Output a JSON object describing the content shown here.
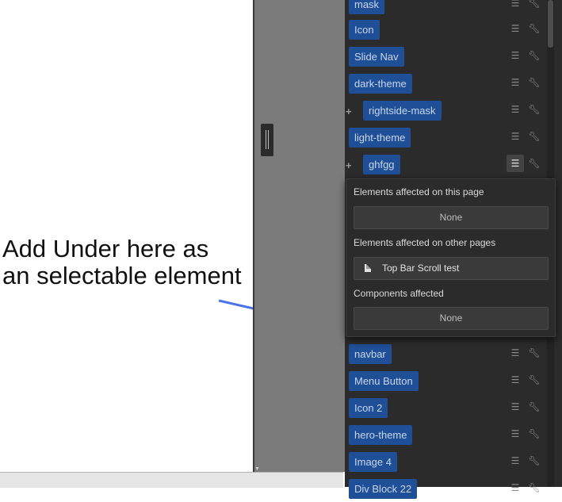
{
  "annotation": {
    "line1": "Add Under here as",
    "line2": "an selectable element"
  },
  "panel": {
    "items": [
      {
        "label": "mask"
      },
      {
        "label": "Icon"
      },
      {
        "label": "Slide Nav"
      },
      {
        "label": "dark-theme"
      },
      {
        "label": "rightside-mask"
      },
      {
        "label": "light-theme"
      },
      {
        "label": "ghfgg"
      },
      {
        "label": "navbar"
      },
      {
        "label": "Menu Button"
      },
      {
        "label": "Icon 2"
      },
      {
        "label": "hero-theme"
      },
      {
        "label": "Image 4"
      },
      {
        "label": "Div Block 22"
      }
    ]
  },
  "popover": {
    "this_page_label": "Elements affected on this page",
    "this_page_value": "None",
    "other_pages_label": "Elements affected on other pages",
    "other_pages_value": "Top Bar Scroll test",
    "components_label": "Components affected",
    "components_value": "None"
  },
  "icons": {
    "list": "list-icon",
    "wrench": "wrench-icon",
    "plus": "plus-icon",
    "document": "document-icon",
    "arrow": "arrow-pointer"
  },
  "colors": {
    "tag_bg": "#1f4f96",
    "panel_bg": "#2b2b2b",
    "arrow": "#4a74e8"
  }
}
